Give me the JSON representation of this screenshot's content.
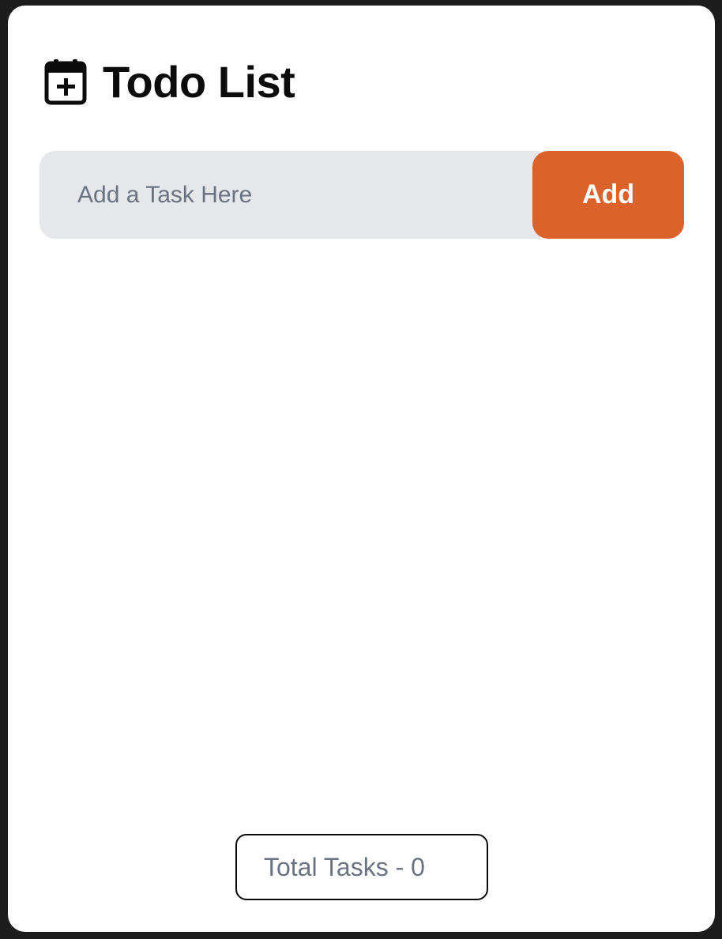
{
  "header": {
    "title": "Todo List",
    "icon": "calendar-plus-icon"
  },
  "task_input": {
    "placeholder": "Add a Task Here",
    "value": ""
  },
  "add_button": {
    "label": "Add"
  },
  "tasks": [],
  "footer": {
    "total_label": "Total Tasks - 0"
  },
  "colors": {
    "accent": "#dc622b",
    "input_bg": "#e5e7eb",
    "page_bg": "#1c1c1c",
    "card_bg": "#ffffff",
    "muted_text": "#6b7280"
  }
}
